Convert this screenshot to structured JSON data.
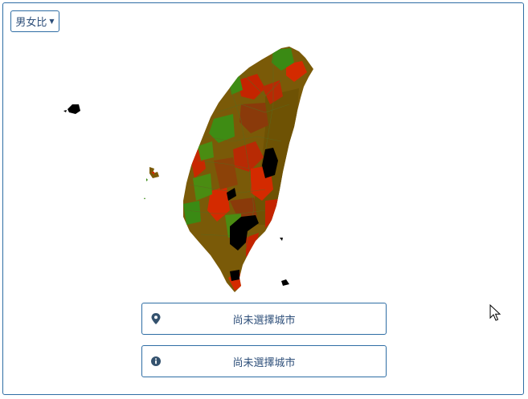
{
  "map_type_dropdown": {
    "label": "男女比",
    "caret_icon": "caret-down-icon"
  },
  "city_select": {
    "label": "尚未選擇城市",
    "icon": "map-marker-icon"
  },
  "city_info": {
    "label": "尚未選擇城市",
    "icon": "info-circle-icon"
  },
  "map": {
    "legend_colors": {
      "green": "#3a8a14",
      "olive": "#7a5e06",
      "brown": "#8a3a0a",
      "red": "#d42a00",
      "no_data": "#000000"
    }
  },
  "colors": {
    "accent_border": "#2e6da4",
    "text": "#2e4f7a"
  }
}
